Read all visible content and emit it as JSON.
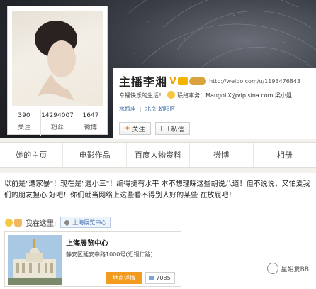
{
  "profile": {
    "name": "主播李湘",
    "url": "http://weibo.com/u/1193476843",
    "bio": "幸福快乐的生活！",
    "contact": "联络事务：MangoLX@vip.sina.com 梁小姐",
    "tags": [
      "水瓶座",
      "北京 朝阳区"
    ],
    "stats": [
      {
        "value": "390",
        "label": "关注"
      },
      {
        "value": "14294007",
        "label": "粉丝"
      },
      {
        "value": "1647",
        "label": "微博"
      }
    ],
    "follow_label": "关注",
    "message_label": "私信"
  },
  "tabs": [
    "她的主页",
    "电影作品",
    "百度人物资料",
    "微博",
    "相册"
  ],
  "post": {
    "text": "以前是\"遭家暴\"！现在是\"遇小三\"！编得挺有水平 本不想理睬这些胡说八道！但不说说，又怕爱我们的朋友担心 好吧！你们就当网络上这些看不得别人好的某些 在放屁吧！",
    "here_label": "我在这里:",
    "location_chip": "上海展览中心"
  },
  "location_card": {
    "title": "上海展览中心",
    "address": "静安区延安中路1000号(近铜仁路)",
    "detail_label": "地点详情",
    "count": "7085"
  },
  "watermark": "星姐爱BB"
}
